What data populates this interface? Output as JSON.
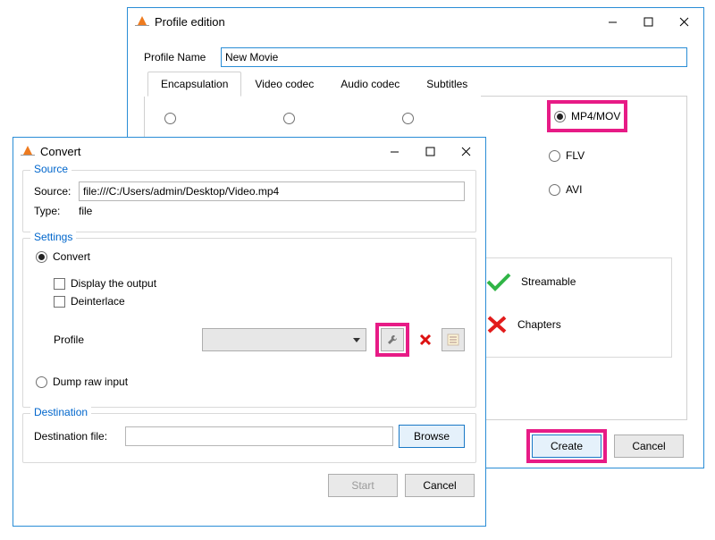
{
  "profileWindow": {
    "title": "Profile edition",
    "nameLabel": "Profile Name",
    "nameValue": "New Movie",
    "tabs": {
      "encapsulation": "Encapsulation",
      "videoCodec": "Video codec",
      "audioCodec": "Audio codec",
      "subtitles": "Subtitles"
    },
    "formats": {
      "mp4mov": "MP4/MOV",
      "flv": "FLV",
      "avi": "AVI"
    },
    "features": {
      "streamable": "Streamable",
      "chapters": "Chapters"
    },
    "buttons": {
      "create": "Create",
      "cancel": "Cancel"
    }
  },
  "convertWindow": {
    "title": "Convert",
    "sourceGroup": "Source",
    "sourceLabel": "Source:",
    "sourceValue": "file:///C:/Users/admin/Desktop/Video.mp4",
    "typeLabel": "Type:",
    "typeValue": "file",
    "settingsGroup": "Settings",
    "convertRadio": "Convert",
    "displayOutput": "Display the output",
    "deinterlace": "Deinterlace",
    "profileLabel": "Profile",
    "dumpRaw": "Dump raw input",
    "destinationGroup": "Destination",
    "destFileLabel": "Destination file:",
    "destFileValue": "",
    "browse": "Browse",
    "start": "Start",
    "cancel": "Cancel"
  }
}
